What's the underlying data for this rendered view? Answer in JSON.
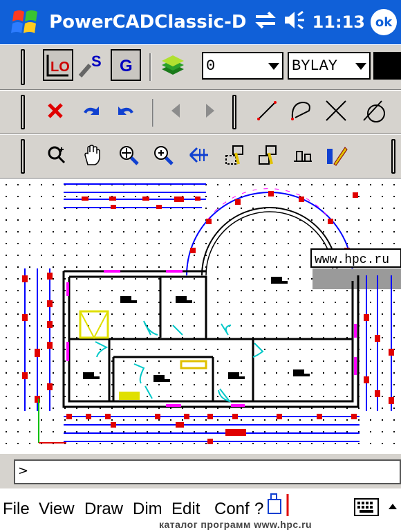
{
  "titlebar": {
    "title": "PowerCADClassic-D",
    "time": "11:13",
    "ok_label": "ok"
  },
  "toolbar1": {
    "layer_value": "0",
    "linetype_value": "BYLAY"
  },
  "drawing": {
    "watermark": "www.hpc.ru"
  },
  "command_line": {
    "prompt": ">"
  },
  "menubar": {
    "items": [
      "File",
      "View",
      "Draw",
      "Dim",
      "Edit",
      "Conf",
      "?"
    ]
  },
  "banner": {
    "text": "каталог программ www.hpc.ru"
  },
  "colors": {
    "titlebar": "#1060d8",
    "toolbar": "#d6d3ce",
    "dimension_blue": "#0000ff",
    "marker_red": "#ff0000",
    "door_cyan": "#00cccc"
  }
}
